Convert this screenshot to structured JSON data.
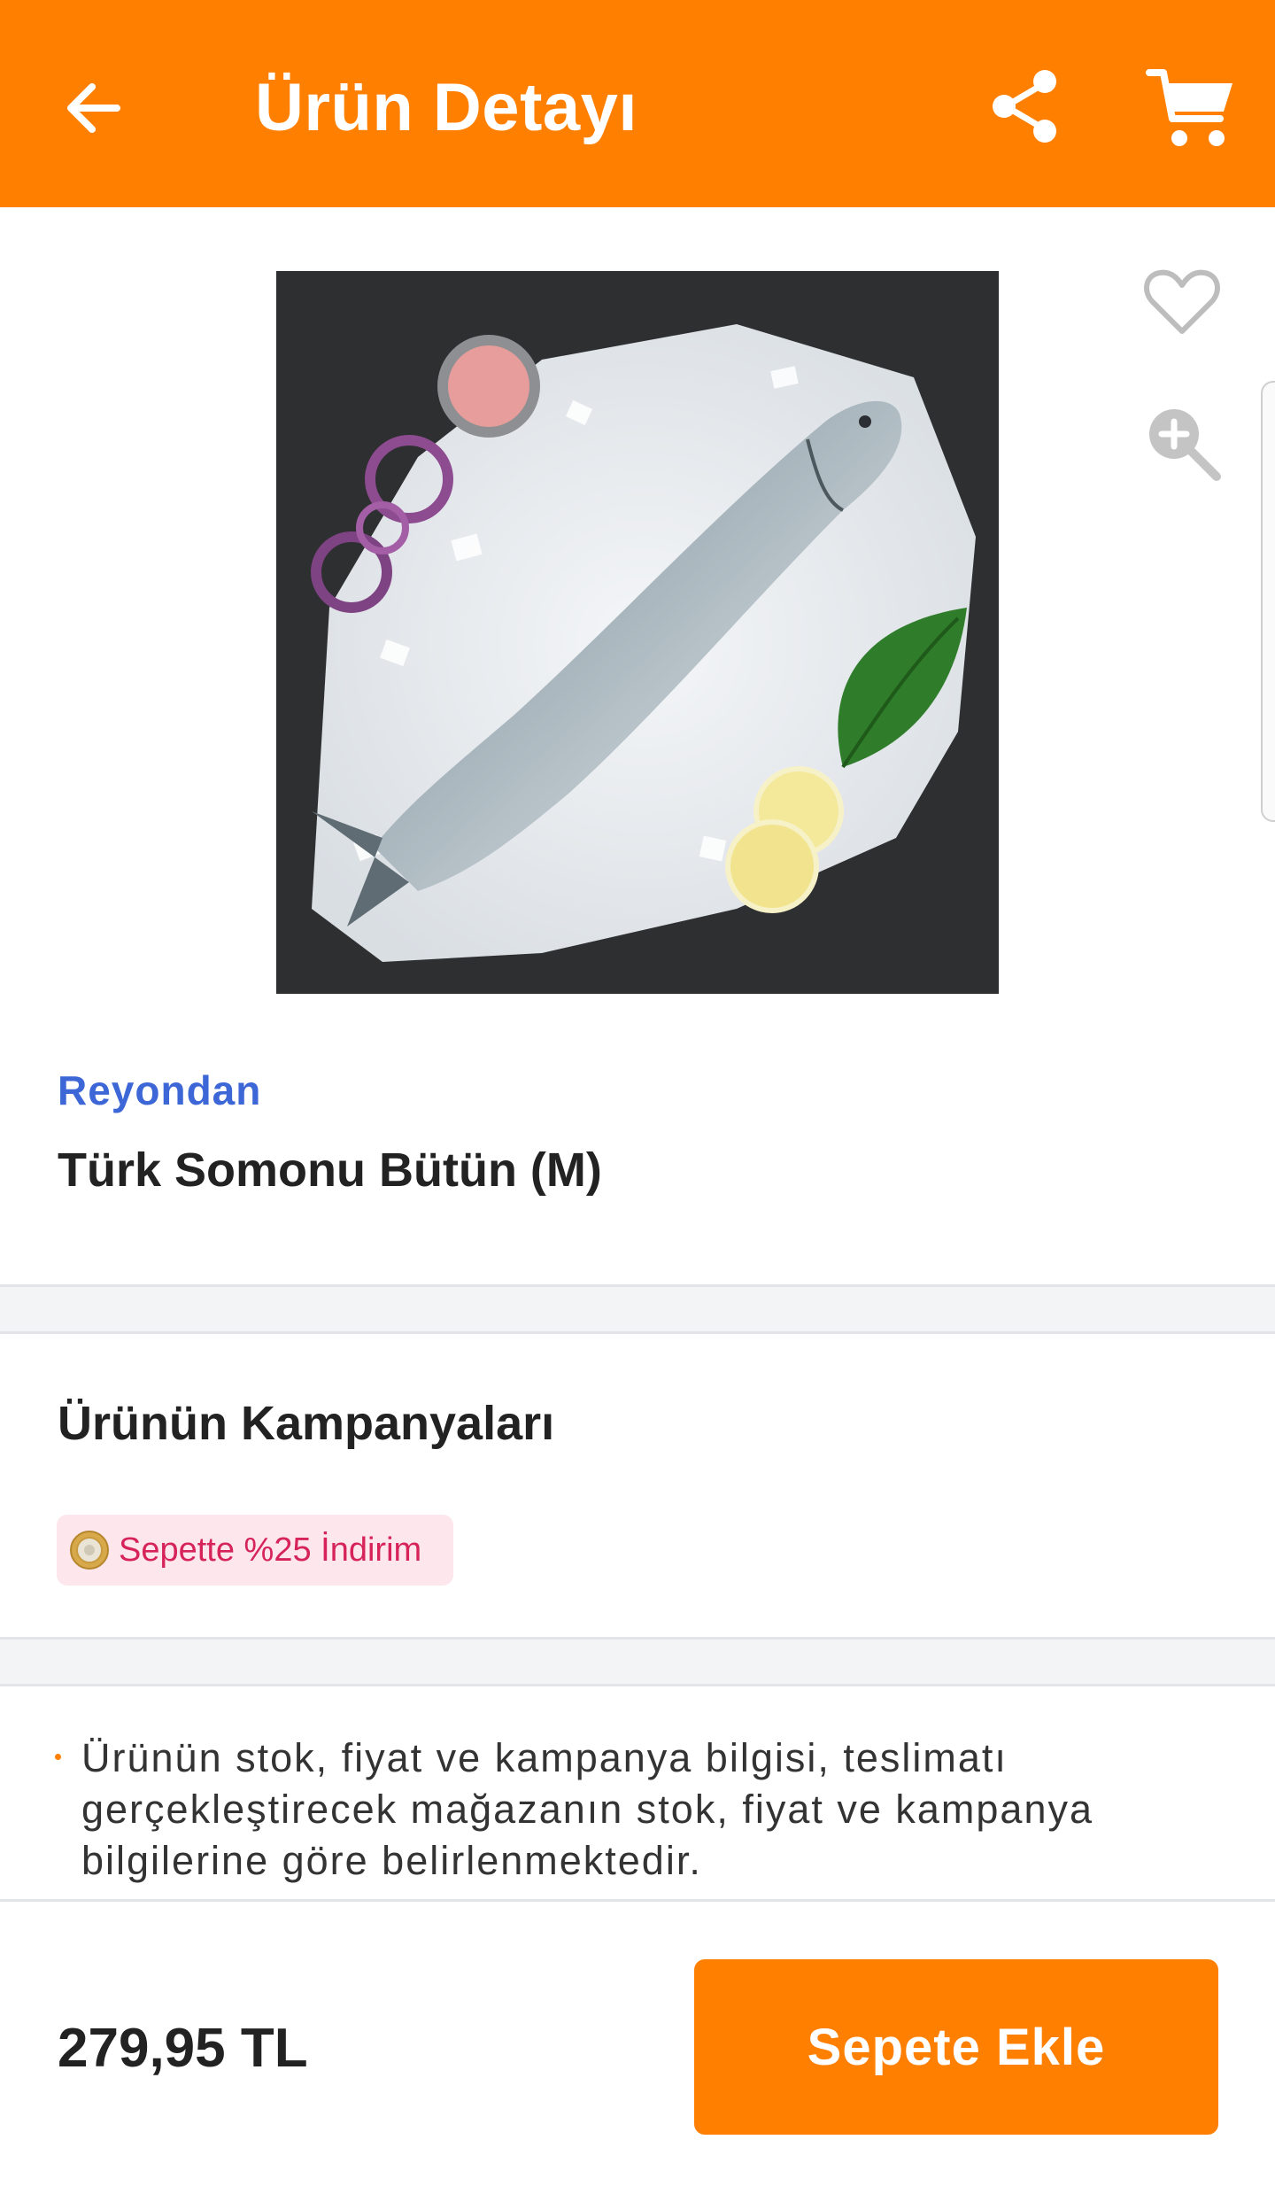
{
  "header": {
    "title": "Ürün Detayı",
    "back_icon": "arrow-left-icon",
    "share_icon": "share-icon",
    "cart_icon": "cart-icon",
    "background_color": "#ff7f00"
  },
  "product": {
    "image_alt": "salmon on ice",
    "brand": "Reyondan",
    "name": "Türk Somonu Bütün (M)",
    "favorite_icon": "heart-outline-icon",
    "zoom_icon": "zoom-in-icon"
  },
  "campaigns": {
    "title": "Ürünün Kampanyaları",
    "items": [
      {
        "label": "Sepette %25 İndirim",
        "icon": "coin-icon"
      }
    ]
  },
  "info": {
    "text": "Ürünün stok, fiyat ve kampanya bilgisi, teslimatı gerçekleştirecek mağazanın stok, fiyat ve kampanya bilgilerine göre belirlenmektedir."
  },
  "bottom_bar": {
    "price": "279,95 TL",
    "add_to_cart_label": "Sepete Ekle"
  },
  "colors": {
    "accent": "#ff7f00",
    "brand_text": "#3d67d6",
    "campaign_text": "#d6245b",
    "campaign_bg": "#fde6ec"
  }
}
